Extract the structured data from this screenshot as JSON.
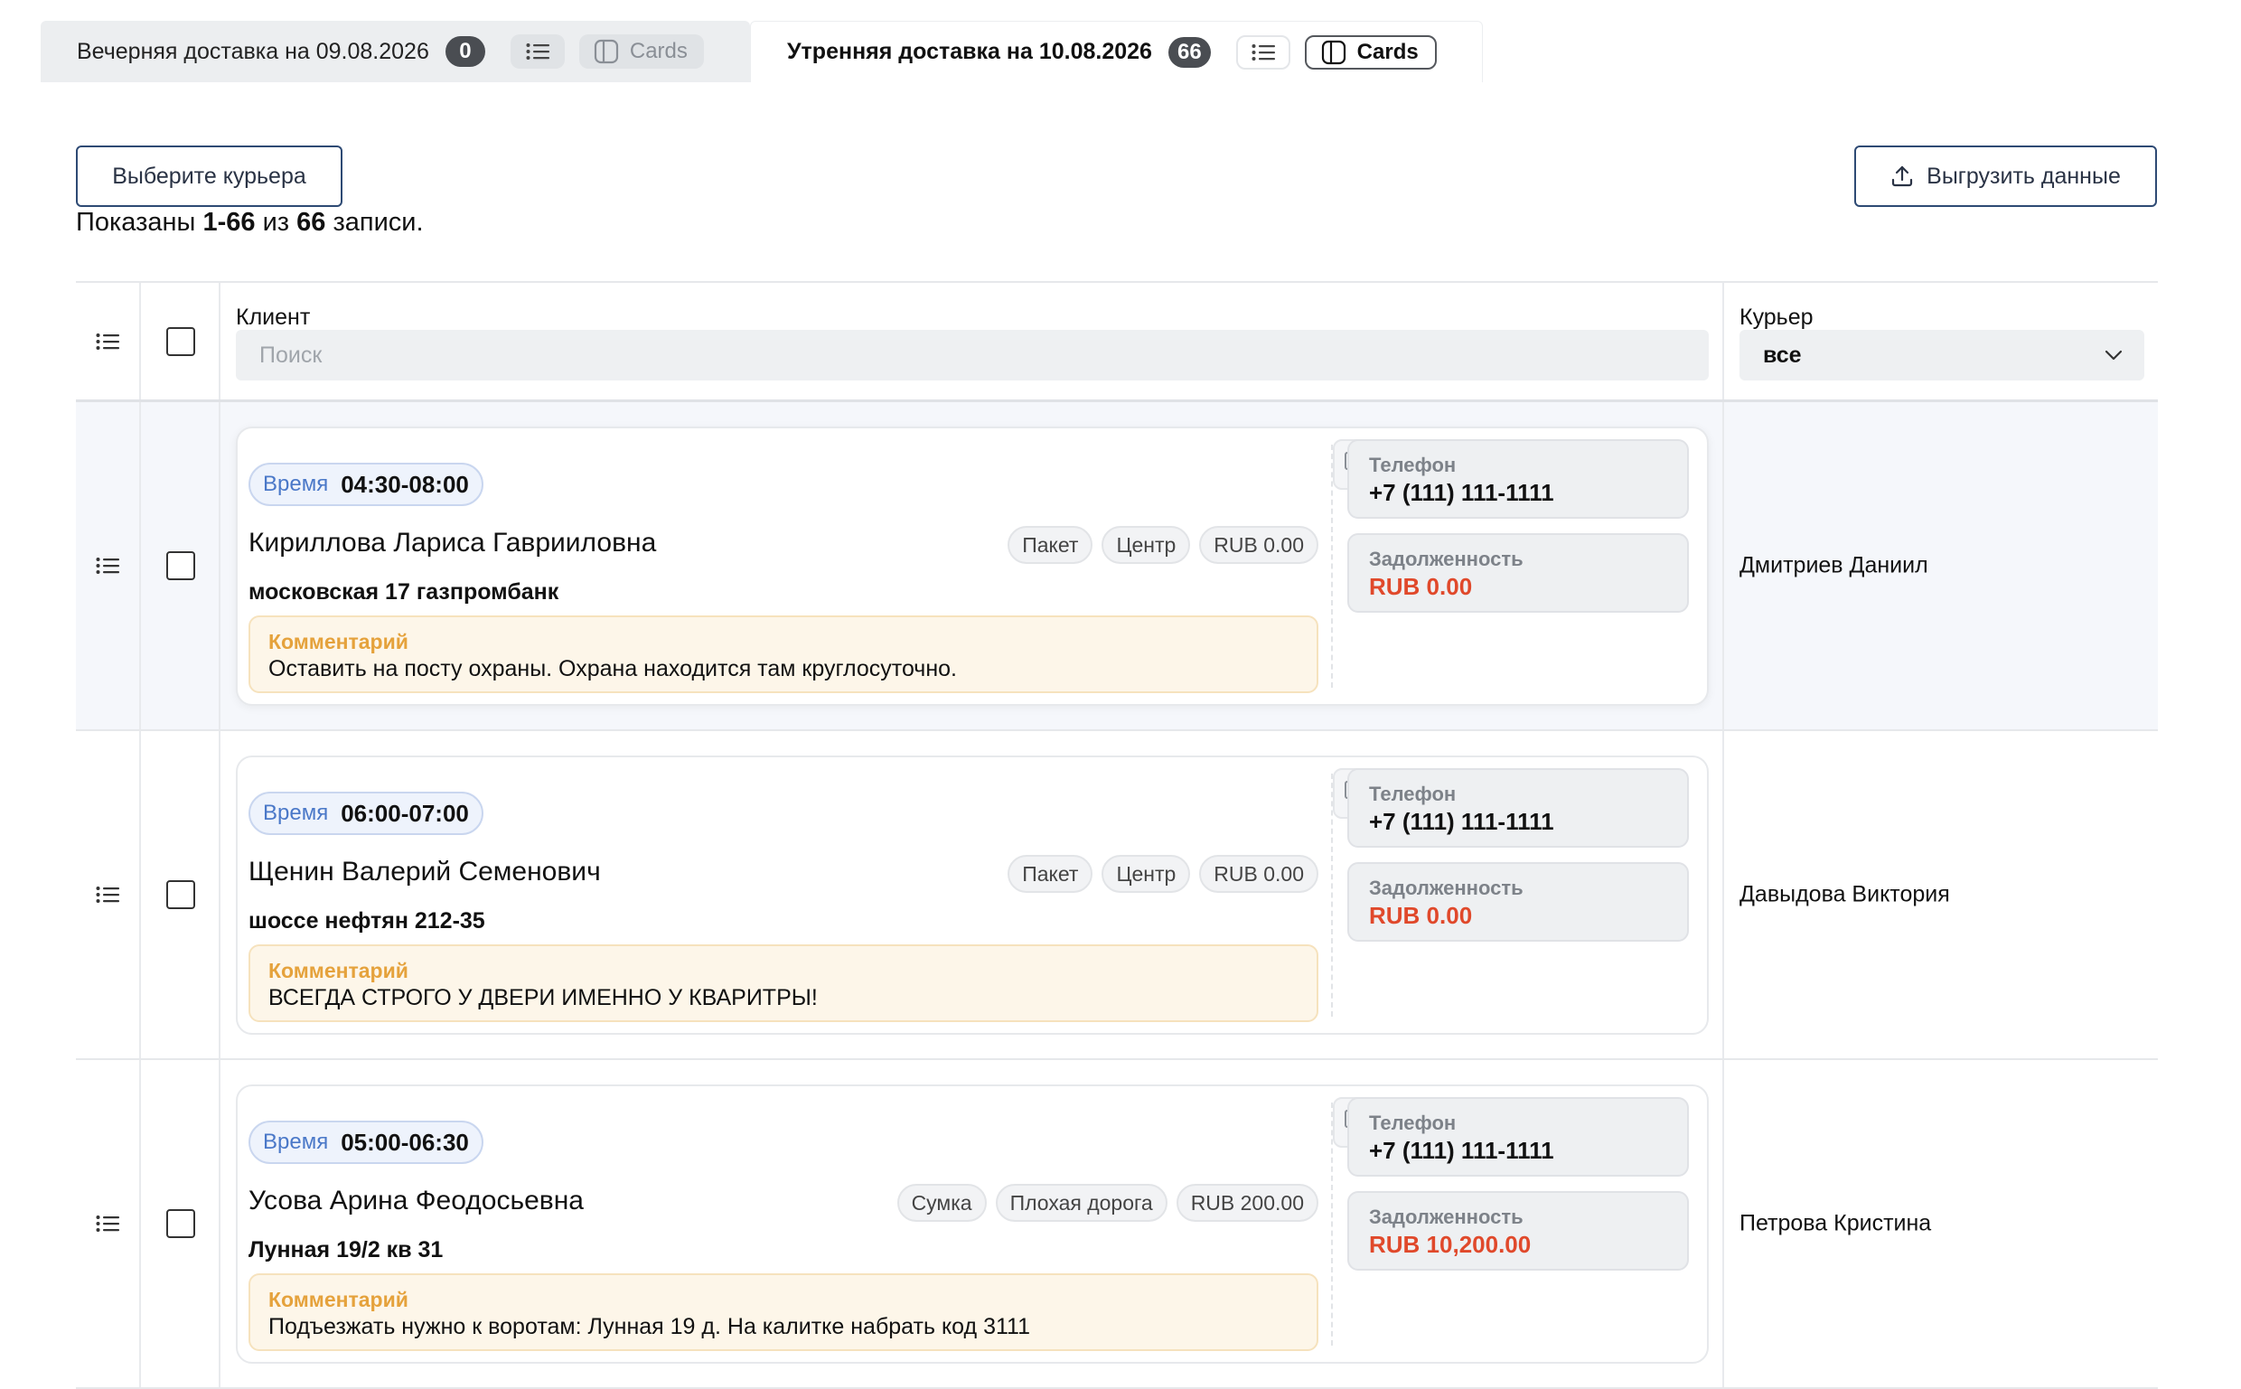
{
  "tabs": [
    {
      "title": "Вечерняя доставка на 09.08.2026",
      "count": "0",
      "cards_label": "Cards",
      "active": false
    },
    {
      "title": "Утренняя доставка на 10.08.2026",
      "count": "66",
      "cards_label": "Cards",
      "active": true
    }
  ],
  "controls": {
    "courier_button": "Выберите курьера",
    "export_button": "Выгрузить данные",
    "shown_prefix": "Показаны",
    "shown_range": "1-66",
    "shown_of": "из",
    "shown_total": "66",
    "shown_suffix": "записи."
  },
  "table": {
    "client_header": "Клиент",
    "search_placeholder": "Поиск",
    "courier_header": "Курьер",
    "courier_filter": "все",
    "labels": {
      "time": "Время",
      "comment": "Комментарий",
      "phone": "Телефон",
      "debt": "Задолженность"
    },
    "rows": [
      {
        "time": "04:30-08:00",
        "name": "Кириллова Лариса Гаврииловна",
        "tags": [
          "Пакет",
          "Центр",
          "RUB 0.00"
        ],
        "address": "московская 17 газпромбанк",
        "comment": "Оставить на посту охраны. Охрана находится там круглосуточно.",
        "phone": "+7 (111) 111-1111",
        "debt": "RUB 0.00",
        "courier": "Дмитриев Даниил"
      },
      {
        "time": "06:00-07:00",
        "name": "Щенин Валерий Семенович",
        "tags": [
          "Пакет",
          "Центр",
          "RUB 0.00"
        ],
        "address": "шоссе нефтян 212-35",
        "comment": "ВСЕГДА СТРОГО У ДВЕРИ ИМЕННО У КВАРИТРЫ!",
        "phone": "+7 (111) 111-1111",
        "debt": "RUB 0.00",
        "courier": "Давыдова Виктория"
      },
      {
        "time": "05:00-06:30",
        "name": "Усова Арина Феодосьевна",
        "tags": [
          "Сумка",
          "Плохая дорога",
          "RUB 200.00"
        ],
        "address": "Лунная 19/2 кв 31",
        "comment": "Подъезжать нужно к воротам: Лунная 19 д. На калитке набрать код 3111",
        "phone": "+7 (111) 111-1111",
        "debt": "RUB 10,200.00",
        "courier": "Петрова Кристина"
      }
    ]
  },
  "colors": {
    "accent_blue": "#4a78c8",
    "debt_red": "#e0492b",
    "comment_label": "#e5a23c",
    "button_border": "#2e4a74"
  },
  "icons": [
    "list-icon",
    "cards-icon",
    "upload-icon",
    "chevron-down-icon",
    "drag-handle-icon",
    "truck-icon"
  ]
}
